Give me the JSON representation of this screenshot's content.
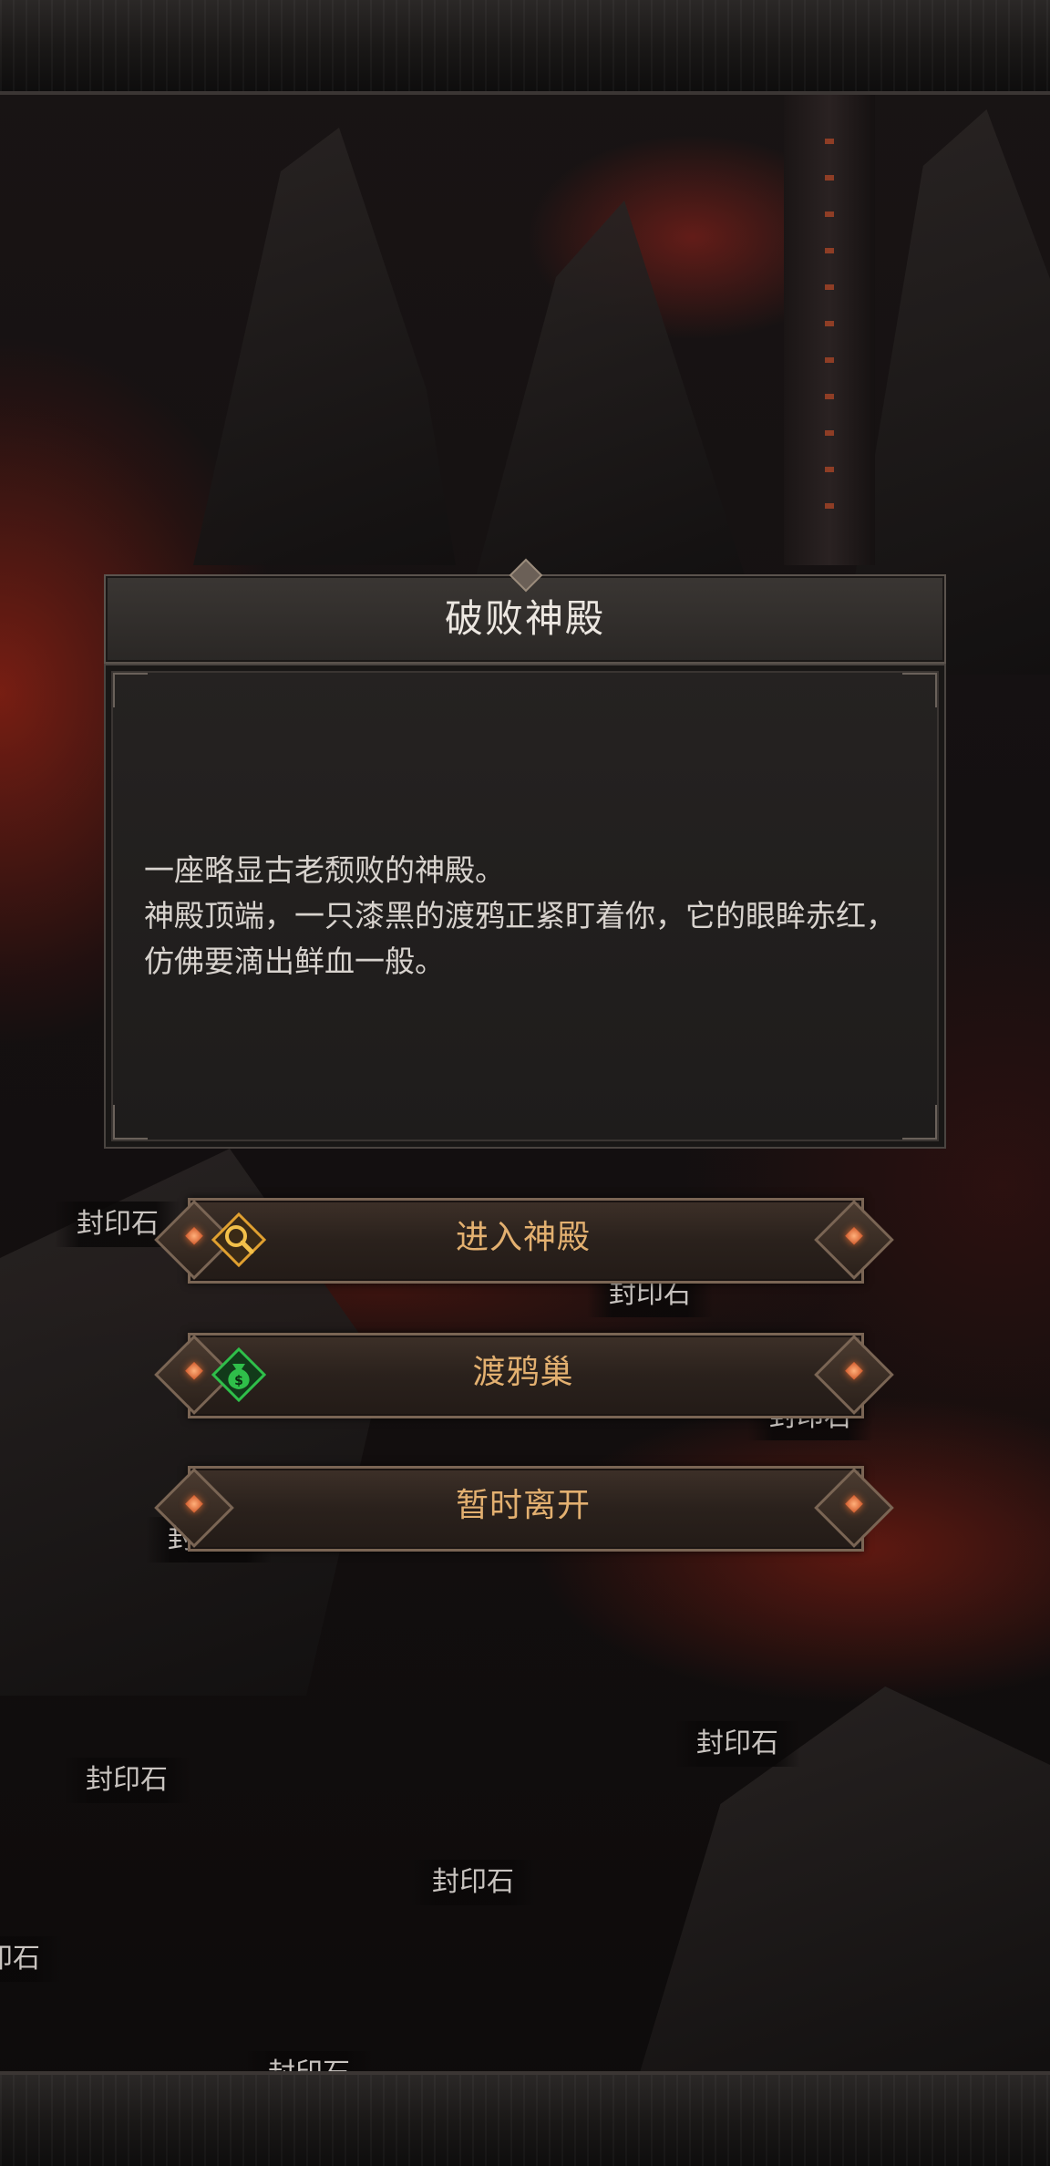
{
  "dialog": {
    "title": "破败神殿",
    "lines": [
      "一座略显古老颓败的神殿。",
      "神殿顶端，一只漆黑的渡鸦正紧盯着你，它的眼眸赤红，仿佛要滴出鲜血一般。"
    ]
  },
  "choices": [
    {
      "label": "进入神殿",
      "icon": "magnifier-icon"
    },
    {
      "label": "渡鸦巢",
      "icon": "money-bag-icon"
    },
    {
      "label": "暂时离开",
      "icon": ""
    }
  ],
  "map_labels": {
    "a": "封印石",
    "b": "封印石",
    "c": "封印石",
    "d": "封印石",
    "e": "封印石",
    "f": "封印石",
    "g": "封印石",
    "h": "封印石",
    "i": "封印石"
  },
  "colors": {
    "button_text": "#e3b070",
    "gem": "#d0582a",
    "icon_green": "#2fbf4a",
    "icon_gold": "#e0a030"
  }
}
